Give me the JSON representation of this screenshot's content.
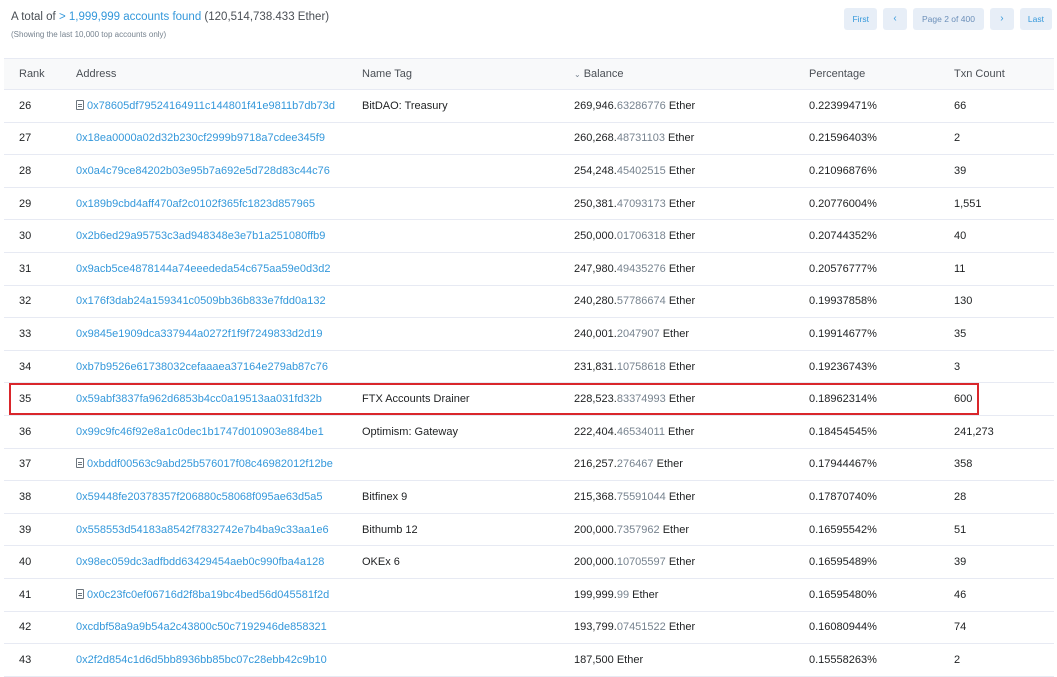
{
  "summary": {
    "prefix": "A total of ",
    "link": "> 1,999,999 accounts found",
    "suffix": " (120,514,738.433 Ether)",
    "note": "(Showing the last 10,000 top accounts only)"
  },
  "pager": {
    "first": "First",
    "prev": "‹",
    "info": "Page 2 of 400",
    "next": "›",
    "last": "Last"
  },
  "columns": {
    "rank": "Rank",
    "address": "Address",
    "name_tag": "Name Tag",
    "balance": "Balance",
    "percentage": "Percentage",
    "txn_count": "Txn Count"
  },
  "rows": [
    {
      "rank": "26",
      "contract": true,
      "address": "0x78605df79524164911c144801f41e9811b7db73d",
      "tag": "BitDAO: Treasury",
      "bal_int": "269,946.",
      "bal_dec": "63286776",
      "unit": " Ether",
      "pct": "0.22399471%",
      "txn": "66"
    },
    {
      "rank": "27",
      "contract": false,
      "address": "0x18ea0000a02d32b230cf2999b9718a7cdee345f9",
      "tag": "",
      "bal_int": "260,268.",
      "bal_dec": "48731103",
      "unit": " Ether",
      "pct": "0.21596403%",
      "txn": "2"
    },
    {
      "rank": "28",
      "contract": false,
      "address": "0x0a4c79ce84202b03e95b7a692e5d728d83c44c76",
      "tag": "",
      "bal_int": "254,248.",
      "bal_dec": "45402515",
      "unit": " Ether",
      "pct": "0.21096876%",
      "txn": "39"
    },
    {
      "rank": "29",
      "contract": false,
      "address": "0x189b9cbd4aff470af2c0102f365fc1823d857965",
      "tag": "",
      "bal_int": "250,381.",
      "bal_dec": "47093173",
      "unit": " Ether",
      "pct": "0.20776004%",
      "txn": "1,551"
    },
    {
      "rank": "30",
      "contract": false,
      "address": "0x2b6ed29a95753c3ad948348e3e7b1a251080ffb9",
      "tag": "",
      "bal_int": "250,000.",
      "bal_dec": "01706318",
      "unit": " Ether",
      "pct": "0.20744352%",
      "txn": "40"
    },
    {
      "rank": "31",
      "contract": false,
      "address": "0x9acb5ce4878144a74eeededa54c675aa59e0d3d2",
      "tag": "",
      "bal_int": "247,980.",
      "bal_dec": "49435276",
      "unit": " Ether",
      "pct": "0.20576777%",
      "txn": "11"
    },
    {
      "rank": "32",
      "contract": false,
      "address": "0x176f3dab24a159341c0509bb36b833e7fdd0a132",
      "tag": "",
      "bal_int": "240,280.",
      "bal_dec": "57786674",
      "unit": " Ether",
      "pct": "0.19937858%",
      "txn": "130"
    },
    {
      "rank": "33",
      "contract": false,
      "address": "0x9845e1909dca337944a0272f1f9f7249833d2d19",
      "tag": "",
      "bal_int": "240,001.",
      "bal_dec": "2047907",
      "unit": " Ether",
      "pct": "0.19914677%",
      "txn": "35"
    },
    {
      "rank": "34",
      "contract": false,
      "address": "0xb7b9526e61738032cefaaaea37164e279ab87c76",
      "tag": "",
      "bal_int": "231,831.",
      "bal_dec": "10758618",
      "unit": " Ether",
      "pct": "0.19236743%",
      "txn": "3"
    },
    {
      "rank": "35",
      "contract": false,
      "address": "0x59abf3837fa962d6853b4cc0a19513aa031fd32b",
      "tag": "FTX Accounts Drainer",
      "bal_int": "228,523.",
      "bal_dec": "83374993",
      "unit": " Ether",
      "pct": "0.18962314%",
      "txn": "600"
    },
    {
      "rank": "36",
      "contract": false,
      "address": "0x99c9fc46f92e8a1c0dec1b1747d010903e884be1",
      "tag": "Optimism: Gateway",
      "bal_int": "222,404.",
      "bal_dec": "46534011",
      "unit": " Ether",
      "pct": "0.18454545%",
      "txn": "241,273"
    },
    {
      "rank": "37",
      "contract": true,
      "address": "0xbddf00563c9abd25b576017f08c46982012f12be",
      "tag": "",
      "bal_int": "216,257.",
      "bal_dec": "276467",
      "unit": " Ether",
      "pct": "0.17944467%",
      "txn": "358"
    },
    {
      "rank": "38",
      "contract": false,
      "address": "0x59448fe20378357f206880c58068f095ae63d5a5",
      "tag": "Bitfinex 9",
      "bal_int": "215,368.",
      "bal_dec": "75591044",
      "unit": " Ether",
      "pct": "0.17870740%",
      "txn": "28"
    },
    {
      "rank": "39",
      "contract": false,
      "address": "0x558553d54183a8542f7832742e7b4ba9c33aa1e6",
      "tag": "Bithumb 12",
      "bal_int": "200,000.",
      "bal_dec": "7357962",
      "unit": " Ether",
      "pct": "0.16595542%",
      "txn": "51"
    },
    {
      "rank": "40",
      "contract": false,
      "address": "0x98ec059dc3adfbdd63429454aeb0c990fba4a128",
      "tag": "OKEx 6",
      "bal_int": "200,000.",
      "bal_dec": "10705597",
      "unit": " Ether",
      "pct": "0.16595489%",
      "txn": "39"
    },
    {
      "rank": "41",
      "contract": true,
      "address": "0x0c23fc0ef06716d2f8ba19bc4bed56d045581f2d",
      "tag": "",
      "bal_int": "199,999.",
      "bal_dec": "99",
      "unit": " Ether",
      "pct": "0.16595480%",
      "txn": "46"
    },
    {
      "rank": "42",
      "contract": false,
      "address": "0xcdbf58a9a9b54a2c43800c50c7192946de858321",
      "tag": "",
      "bal_int": "193,799.",
      "bal_dec": "07451522",
      "unit": " Ether",
      "pct": "0.16080944%",
      "txn": "74"
    },
    {
      "rank": "43",
      "contract": false,
      "address": "0x2f2d854c1d6d5bb8936bb85bc07c28ebb42c9b10",
      "tag": "",
      "bal_int": "187,500",
      "bal_dec": "",
      "unit": " Ether",
      "pct": "0.15558263%",
      "txn": "2"
    }
  ],
  "highlight_rank": "35",
  "colors": {
    "link": "#3498db",
    "highlight": "#d9262b",
    "muted": "#77838f"
  }
}
